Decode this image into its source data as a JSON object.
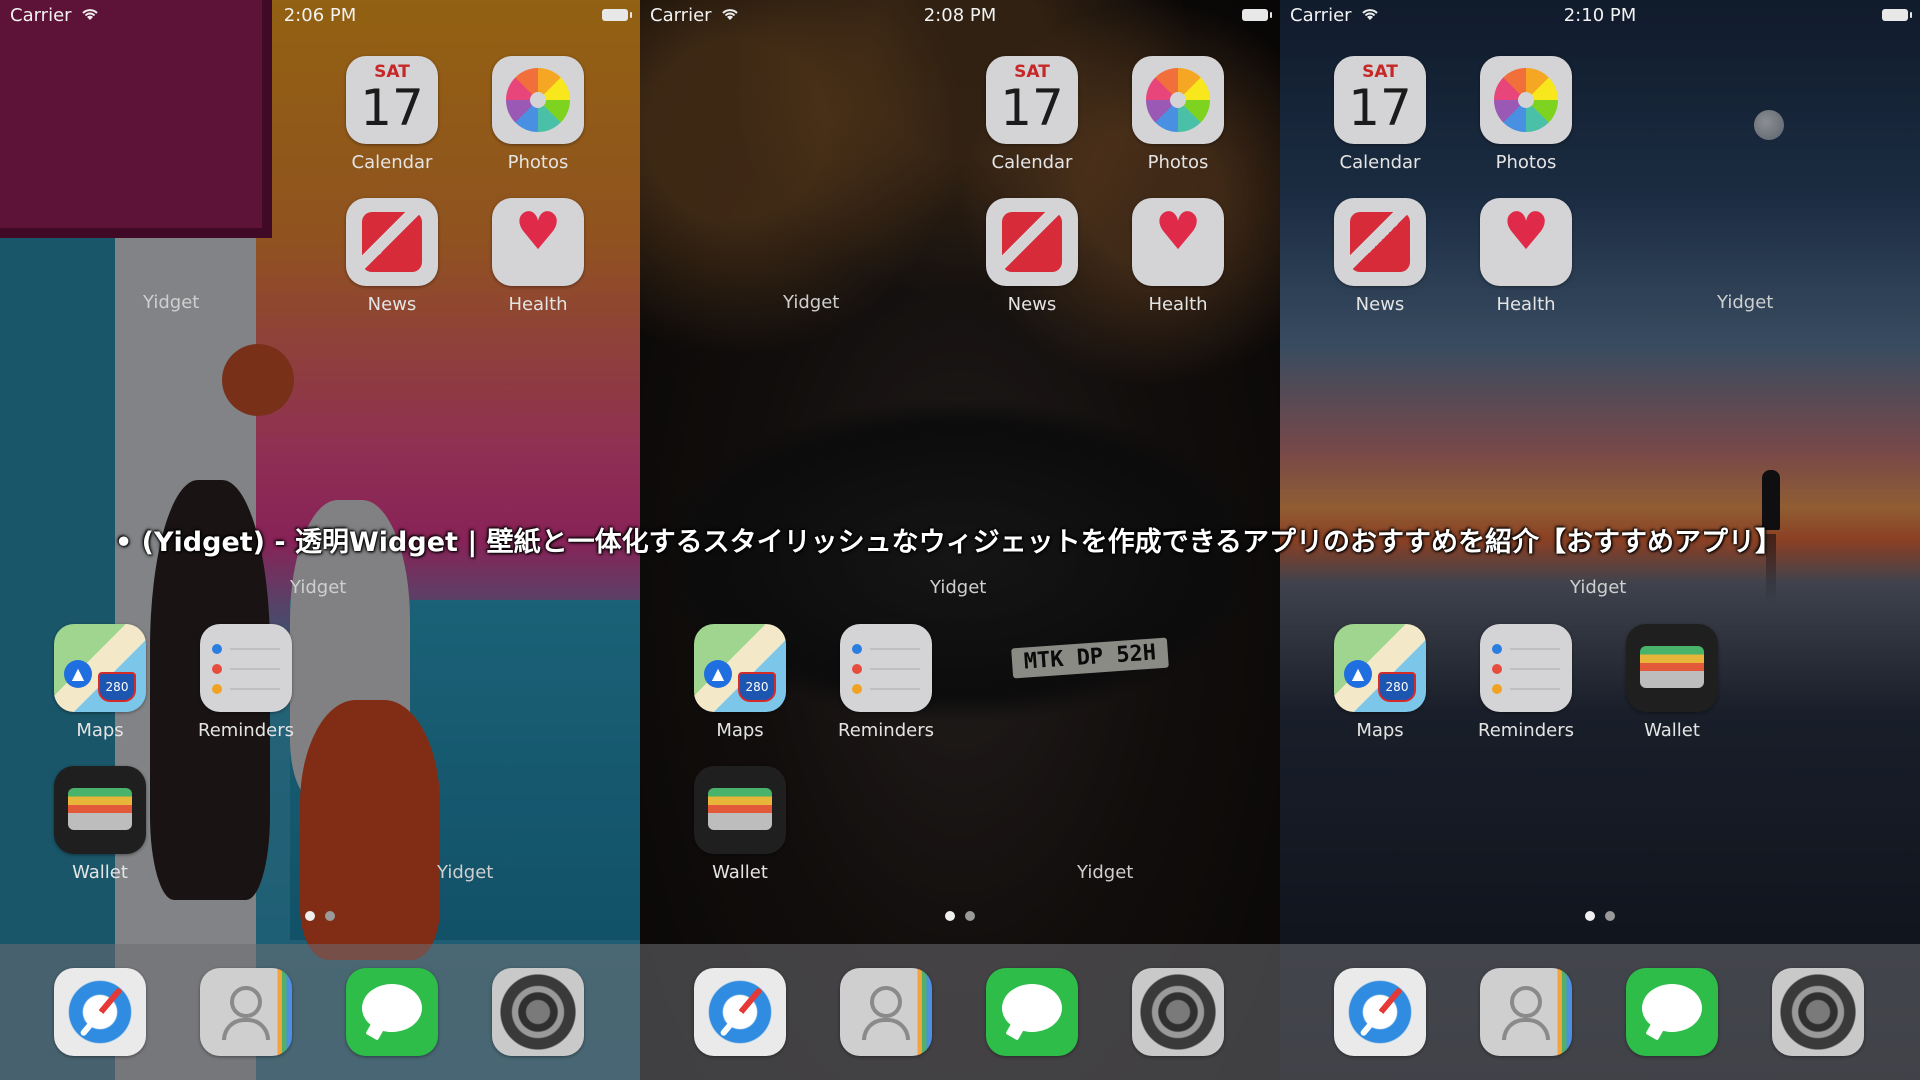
{
  "caption": "• (Yidget) - 透明Widget | 壁紙と一体化するスタイリッシュなウィジェットを作成できるアプリのおすすめを紹介【おすすめアプリ】",
  "status": {
    "carrier": "Carrier",
    "times": [
      "2:06 PM",
      "2:08 PM",
      "2:10 PM"
    ]
  },
  "icons": {
    "wifi": "wifi-icon",
    "battery": "battery-icon"
  },
  "apps": {
    "calendar": {
      "label": "Calendar",
      "day": "SAT",
      "date": "17"
    },
    "photos": {
      "label": "Photos"
    },
    "news": {
      "label": "News"
    },
    "health": {
      "label": "Health",
      "glyph": "♥"
    },
    "maps": {
      "label": "Maps",
      "shield": "280"
    },
    "reminders": {
      "label": "Reminders"
    },
    "wallet": {
      "label": "Wallet"
    }
  },
  "widget_label": "Yidget",
  "plate": "MTK DP 52H",
  "dock": [
    "Safari",
    "Contacts",
    "Messages",
    "Settings"
  ],
  "colors": {
    "dim_overlay": "#000000",
    "caption_text": "#ffffff",
    "dock": "#6e6e73"
  }
}
